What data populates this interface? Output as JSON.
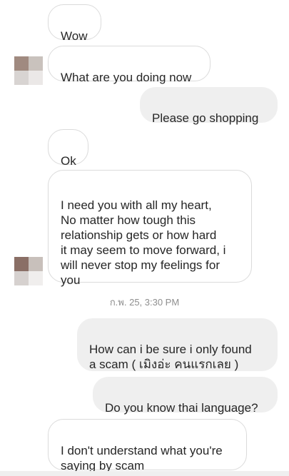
{
  "messages": [
    {
      "direction": "incoming",
      "text": "Wow"
    },
    {
      "direction": "incoming",
      "text": "What are you doing now"
    },
    {
      "direction": "outgoing",
      "text": "Please go shopping"
    },
    {
      "direction": "incoming",
      "text": "Ok"
    },
    {
      "direction": "incoming",
      "text": "I need you with all my heart,\nNo matter how tough this\nrelationship gets or how hard\nit may seem to move forward, i\nwill never stop my feelings for\nyou"
    },
    {
      "direction": "outgoing",
      "text": "How can i be sure i only found\na scam ( เมิงอ่ะ คนแรกเลย )"
    },
    {
      "direction": "outgoing",
      "text": "Do you know thai language?"
    },
    {
      "direction": "incoming",
      "text": "I don't understand what you're\nsaying by scam"
    }
  ],
  "timestamp": "ก.พ. 25, 3:30 PM",
  "colors": {
    "incoming_bubble": "#ffffff",
    "incoming_border": "#dbdbdb",
    "outgoing_bubble": "#efefef",
    "text": "#262626",
    "timestamp": "#8e8e8e"
  }
}
